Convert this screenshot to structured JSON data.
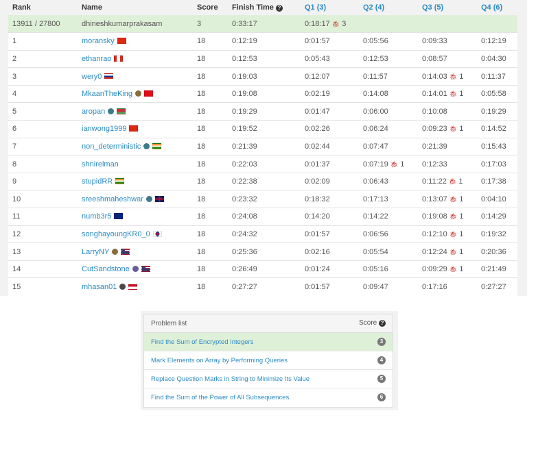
{
  "ranking": {
    "headers": {
      "rank": "Rank",
      "name": "Name",
      "score": "Score",
      "finish_time": "Finish Time",
      "q1": "Q1 (3)",
      "q2": "Q2 (4)",
      "q3": "Q3 (5)",
      "q4": "Q4 (6)"
    },
    "current_user": {
      "rank": "13911 / 27800",
      "name": "dhineshkumarprakasam",
      "score": "3",
      "finish": "0:33:17",
      "q1": "0:18:17",
      "q1_penalty": "3",
      "q2": "",
      "q3": "",
      "q4": ""
    },
    "rows": [
      {
        "rank": "1",
        "name": "moransky",
        "badge": "",
        "flag": "hk",
        "score": "18",
        "finish": "0:12:19",
        "q1": "0:01:57",
        "q1p": "",
        "q2": "0:05:56",
        "q2p": "",
        "q3": "0:09:33",
        "q3p": "",
        "q4": "0:12:19",
        "q4p": ""
      },
      {
        "rank": "2",
        "name": "ethanrao",
        "badge": "",
        "flag": "ca",
        "score": "18",
        "finish": "0:12:53",
        "q1": "0:05:43",
        "q1p": "",
        "q2": "0:12:53",
        "q2p": "",
        "q3": "0:08:57",
        "q3p": "",
        "q4": "0:04:30",
        "q4p": ""
      },
      {
        "rank": "3",
        "name": "wery0",
        "badge": "",
        "flag": "ru",
        "score": "18",
        "finish": "0:19:03",
        "q1": "0:12:07",
        "q1p": "",
        "q2": "0:11:57",
        "q2p": "",
        "q3": "0:14:03",
        "q3p": "1",
        "q4": "0:11:37",
        "q4p": ""
      },
      {
        "rank": "4",
        "name": "MkaanTheKing",
        "badge": "guardian",
        "flag": "tr",
        "score": "18",
        "finish": "0:19:08",
        "q1": "0:02:19",
        "q1p": "",
        "q2": "0:14:08",
        "q2p": "",
        "q3": "0:14:01",
        "q3p": "1",
        "q4": "0:05:58",
        "q4p": ""
      },
      {
        "rank": "5",
        "name": "aropan",
        "badge": "knight",
        "flag": "by",
        "score": "18",
        "finish": "0:19:29",
        "q1": "0:01:47",
        "q1p": "",
        "q2": "0:06:00",
        "q2p": "",
        "q3": "0:10:08",
        "q3p": "",
        "q4": "0:19:29",
        "q4p": ""
      },
      {
        "rank": "6",
        "name": "ianwong1999",
        "badge": "",
        "flag": "hk",
        "score": "18",
        "finish": "0:19:52",
        "q1": "0:02:26",
        "q1p": "",
        "q2": "0:06:24",
        "q2p": "",
        "q3": "0:09:23",
        "q3p": "1",
        "q4": "0:14:52",
        "q4p": ""
      },
      {
        "rank": "7",
        "name": "non_deterministic",
        "badge": "knight",
        "flag": "in",
        "score": "18",
        "finish": "0:21:39",
        "q1": "0:02:44",
        "q1p": "",
        "q2": "0:07:47",
        "q2p": "",
        "q3": "0:21:39",
        "q3p": "",
        "q4": "0:15:43",
        "q4p": ""
      },
      {
        "rank": "8",
        "name": "shnirelman",
        "badge": "",
        "flag": "",
        "score": "18",
        "finish": "0:22:03",
        "q1": "0:01:37",
        "q1p": "",
        "q2": "0:07:19",
        "q2p": "1",
        "q3": "0:12:33",
        "q3p": "",
        "q4": "0:17:03",
        "q4p": ""
      },
      {
        "rank": "9",
        "name": "stupidRR",
        "badge": "",
        "flag": "in",
        "score": "18",
        "finish": "0:22:38",
        "q1": "0:02:09",
        "q1p": "",
        "q2": "0:06:43",
        "q2p": "",
        "q3": "0:11:22",
        "q3p": "1",
        "q4": "0:17:38",
        "q4p": ""
      },
      {
        "rank": "10",
        "name": "sreeshmaheshwar",
        "badge": "knight",
        "flag": "gb",
        "score": "18",
        "finish": "0:23:32",
        "q1": "0:18:32",
        "q1p": "",
        "q2": "0:17:13",
        "q2p": "",
        "q3": "0:13:07",
        "q3p": "1",
        "q4": "0:04:10",
        "q4p": ""
      },
      {
        "rank": "11",
        "name": "numb3r5",
        "badge": "",
        "flag": "au",
        "score": "18",
        "finish": "0:24:08",
        "q1": "0:14:20",
        "q1p": "",
        "q2": "0:14:22",
        "q2p": "",
        "q3": "0:19:08",
        "q3p": "1",
        "q4": "0:14:29",
        "q4p": ""
      },
      {
        "rank": "12",
        "name": "songhayoungKR0_0",
        "badge": "",
        "flag": "kr",
        "score": "18",
        "finish": "0:24:32",
        "q1": "0:01:57",
        "q1p": "",
        "q2": "0:06:56",
        "q2p": "",
        "q3": "0:12:10",
        "q3p": "1",
        "q4": "0:19:32",
        "q4p": ""
      },
      {
        "rank": "13",
        "name": "LarryNY",
        "badge": "guardian",
        "flag": "us",
        "score": "18",
        "finish": "0:25:36",
        "q1": "0:02:16",
        "q1p": "",
        "q2": "0:05:54",
        "q2p": "",
        "q3": "0:12:24",
        "q3p": "1",
        "q4": "0:20:36",
        "q4p": ""
      },
      {
        "rank": "14",
        "name": "CutSandstone",
        "badge": "knight-purple",
        "flag": "us",
        "score": "18",
        "finish": "0:26:49",
        "q1": "0:01:24",
        "q1p": "",
        "q2": "0:05:16",
        "q2p": "",
        "q3": "0:09:29",
        "q3p": "1",
        "q4": "0:21:49",
        "q4p": ""
      },
      {
        "rank": "15",
        "name": "mhasan01",
        "badge": "guardian-dark",
        "flag": "id",
        "score": "18",
        "finish": "0:27:27",
        "q1": "0:01:57",
        "q1p": "",
        "q2": "0:09:47",
        "q2p": "",
        "q3": "0:17:16",
        "q3p": "",
        "q4": "0:27:27",
        "q4p": ""
      }
    ]
  },
  "problem_list": {
    "title": "Problem list",
    "score_label": "Score",
    "items": [
      {
        "name": "Find the Sum of Encrypted Integers",
        "points": "3",
        "solved": true
      },
      {
        "name": "Mark Elements on Array by Performing Queries",
        "points": "4",
        "solved": false
      },
      {
        "name": "Replace Question Marks in String to Minimize Its Value",
        "points": "5",
        "solved": false
      },
      {
        "name": "Find the Sum of the Power of All Subsequences",
        "points": "6",
        "solved": false
      }
    ]
  },
  "colors": {
    "link": "#2a8bc4",
    "highlight": "#dff0d8",
    "penalty": "#c9302c",
    "badge_points": "#777777"
  }
}
